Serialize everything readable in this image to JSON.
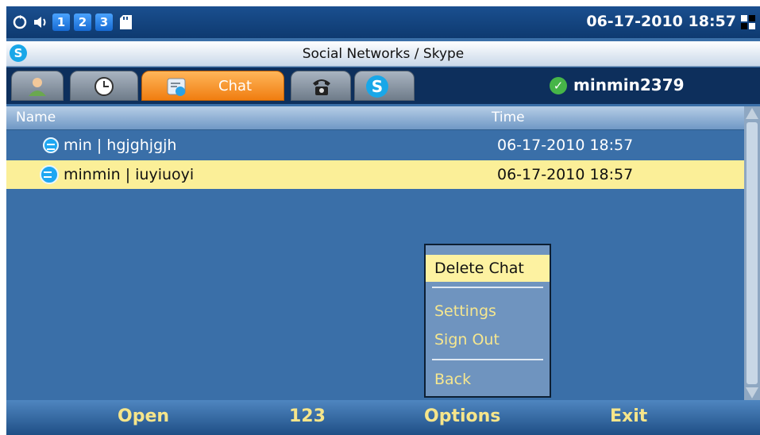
{
  "statusbar": {
    "indicators": [
      "1",
      "2",
      "3"
    ],
    "datetime": "06-17-2010 18:57"
  },
  "titlebar": {
    "logo_letter": "S",
    "title": "Social Networks / Skype"
  },
  "tabs": [
    {
      "icon": "contacts-icon",
      "label": ""
    },
    {
      "icon": "history-clock-icon",
      "label": ""
    },
    {
      "icon": "chat-icon",
      "label": "Chat",
      "active": true
    },
    {
      "icon": "phone-icon",
      "label": ""
    },
    {
      "icon": "skype-icon",
      "label": "S"
    }
  ],
  "user": {
    "status": "online",
    "name": "minmin2379"
  },
  "list": {
    "columns": {
      "name": "Name",
      "time": "Time"
    },
    "rows": [
      {
        "title": "min | hgjghjgjh",
        "time": "06-17-2010 18:57",
        "selected": false
      },
      {
        "title": "minmin | iuyiuoyi",
        "time": "06-17-2010 18:57",
        "selected": true
      }
    ]
  },
  "menu": {
    "items": [
      "Delete Chat",
      "Settings",
      "Sign Out",
      "Back"
    ],
    "selected": "Delete Chat"
  },
  "softkeys": {
    "open": "Open",
    "mode": "123",
    "options": "Options",
    "exit": "Exit"
  },
  "colors": {
    "background": "#3a6fa8",
    "selection": "#fbef98",
    "softkey_text": "#f6e58a",
    "active_tab": "#f07d10"
  }
}
